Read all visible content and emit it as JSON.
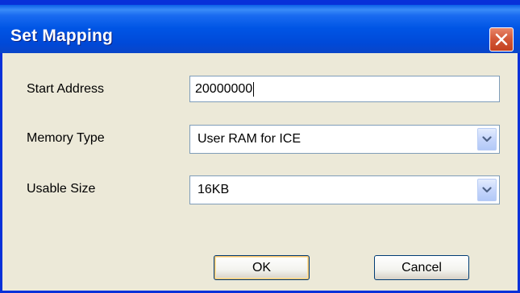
{
  "window": {
    "title": "Set Mapping"
  },
  "form": {
    "start_address": {
      "label": "Start Address",
      "value": "20000000"
    },
    "memory_type": {
      "label": "Memory Type",
      "selected": "User RAM for ICE"
    },
    "usable_size": {
      "label": "Usable Size",
      "selected": "16KB"
    }
  },
  "buttons": {
    "ok_label": "OK",
    "cancel_label": "Cancel"
  },
  "icons": {
    "close": "close-icon",
    "dropdown": "chevron-down-icon"
  },
  "colors": {
    "titlebar": "#0055e5",
    "frame": "#0831d9",
    "dialog_bg": "#ece9d8",
    "close_button": "#d45a3a",
    "field_border": "#7f9db9"
  }
}
